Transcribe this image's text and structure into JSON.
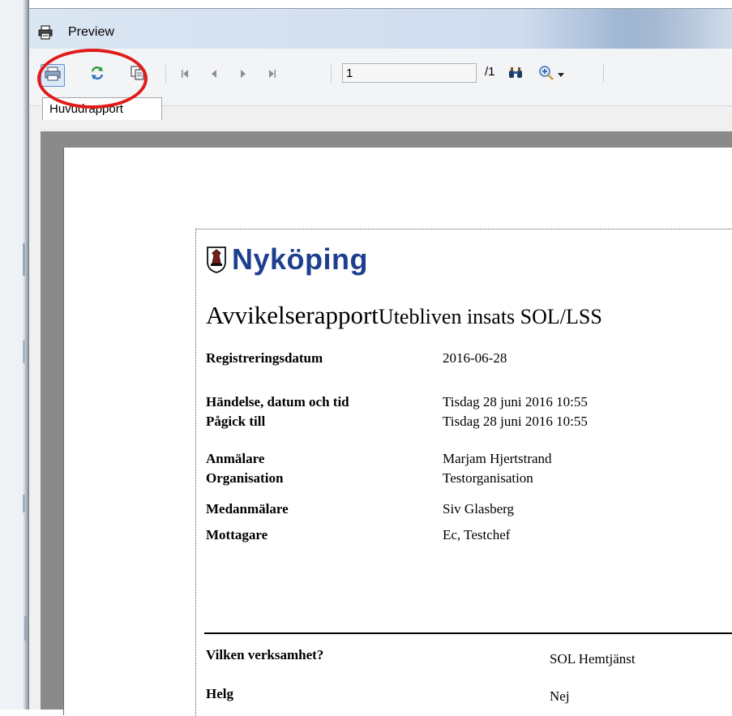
{
  "window": {
    "title": "Preview",
    "title_icon": "printer-icon"
  },
  "toolbar": {
    "print_icon": "printer-icon",
    "refresh_icon": "refresh-icon",
    "copy_icon": "copy-icon",
    "first_icon": "first-page-icon",
    "prev_icon": "previous-page-icon",
    "next_icon": "next-page-icon",
    "last_icon": "last-page-icon",
    "page_value": "1",
    "page_total": "/1",
    "search_icon": "binoculars-icon",
    "zoom_icon": "zoom-in-icon",
    "dropdown_icon": "chevron-down-icon"
  },
  "tabs": {
    "main": "Huvudrapport"
  },
  "highlight": {
    "color": "#e11a1a"
  },
  "report": {
    "logo_text": "Nyköping",
    "title": "Avvikelserapport",
    "subtitle": "Utebliven insats SOL/LSS",
    "fields": [
      {
        "label": "Registreringsdatum",
        "value": "2016-06-28"
      },
      {
        "label": "Händelse, datum och tid",
        "value": "Tisdag 28 juni 2016 10:55"
      },
      {
        "label": "Pågick till",
        "value": "Tisdag 28 juni 2016 10:55"
      },
      {
        "label": "Anmälare",
        "value": "Marjam Hjertstrand"
      },
      {
        "label": "Organisation",
        "value": "Testorganisation"
      },
      {
        "label": "Medanmälare",
        "value": "Siv Glasberg"
      },
      {
        "label": "Mottagare",
        "value": "Ec, Testchef"
      }
    ],
    "questions": [
      {
        "label": "Vilken verksamhet?",
        "value": "SOL Hemtjänst"
      },
      {
        "label": "Helg",
        "value": "Nej"
      }
    ]
  }
}
